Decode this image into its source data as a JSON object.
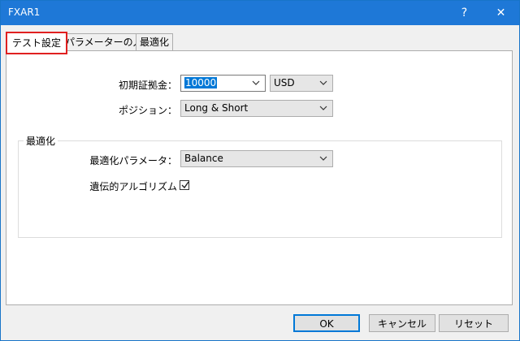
{
  "window": {
    "title": "FXAR1",
    "help_glyph": "?",
    "close_glyph": "✕"
  },
  "tabs": [
    {
      "label": "テスト設定",
      "active": true
    },
    {
      "label": "パラメーターの入力",
      "active": false
    },
    {
      "label": "最適化",
      "active": false
    }
  ],
  "test_settings": {
    "initial_margin_label": "初期証拠金：",
    "initial_margin_value": "10000",
    "currency_value": "USD",
    "position_label": "ポジション：",
    "position_value": "Long & Short"
  },
  "optimization": {
    "group_title": "最適化",
    "param_label": "最適化パラメータ：",
    "param_value": "Balance",
    "genetic_label": "遺伝的アルゴリズム",
    "genetic_checked": true
  },
  "footer": {
    "ok_label": "OK",
    "cancel_label": "キャンセル",
    "reset_label": "リセット"
  },
  "colors": {
    "titlebar": "#1e78d7",
    "highlight": "#e02020",
    "selection": "#0078d7"
  }
}
